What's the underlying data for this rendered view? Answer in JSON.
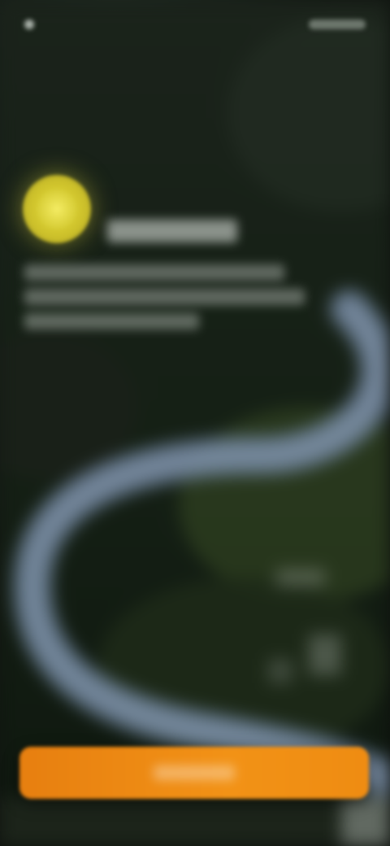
{
  "status_bar": {
    "time": "",
    "indicators": [
      "signal-icon",
      "wifi-icon",
      "battery-icon"
    ]
  },
  "hero": {
    "logo_icon": "sun-logo-icon",
    "logo_color": "#e5d93a",
    "title": "",
    "subtitle_lines": [
      "",
      "",
      ""
    ]
  },
  "cta": {
    "label": "",
    "color": "#f08c12"
  },
  "background": {
    "description_icon": "river-landscape-image"
  }
}
